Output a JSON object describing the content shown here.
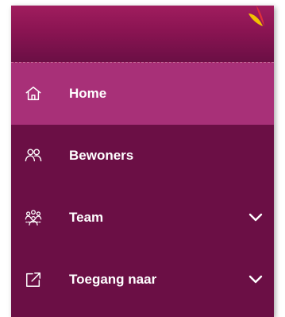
{
  "sidebar": {
    "logo_icon": "brand-leaf-logo",
    "items": [
      {
        "label": "Home",
        "icon": "home-icon",
        "active": true,
        "expandable": false
      },
      {
        "label": "Bewoners",
        "icon": "people-icon",
        "active": false,
        "expandable": false
      },
      {
        "label": "Team",
        "icon": "team-icon",
        "active": false,
        "expandable": true
      },
      {
        "label": "Toegang naar",
        "icon": "external-link-icon",
        "active": false,
        "expandable": true
      }
    ]
  },
  "colors": {
    "sidebar_bg": "#6b0f45",
    "active_bg": "#a83078",
    "logo_yellow": "#f2c200",
    "logo_red": "#e0303a"
  }
}
